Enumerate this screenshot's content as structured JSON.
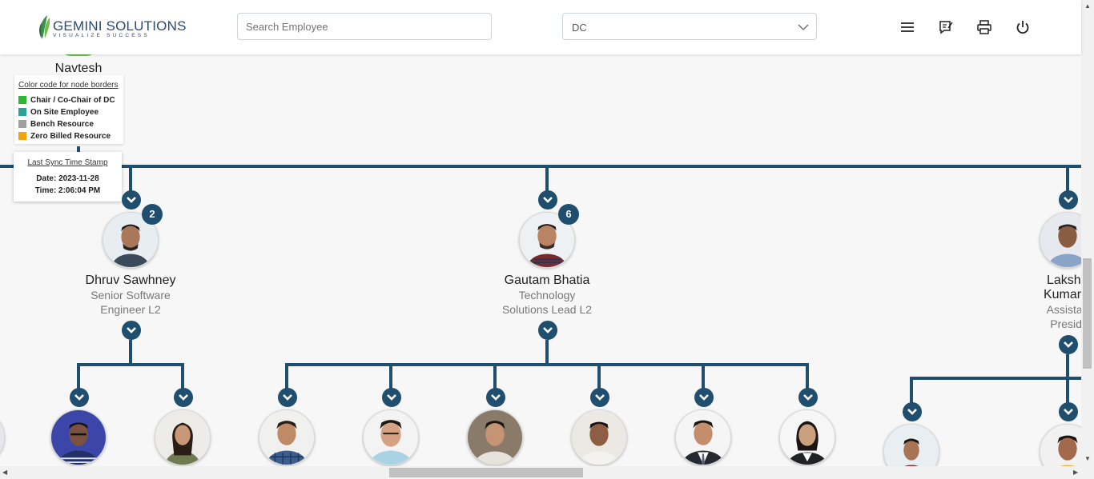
{
  "header": {
    "logo_name": "GEMINI SOLUTIONS",
    "logo_tagline": "VISUALIZE SUCCESS",
    "search_placeholder": "Search Employee",
    "dc_selected": "DC",
    "icons": [
      "menu-icon",
      "feedback-icon",
      "print-icon",
      "power-icon"
    ]
  },
  "colors": {
    "connector": "#1f4e6e",
    "chair": "#2fb52f",
    "onsite": "#2aa19b",
    "bench": "#a0a0a0",
    "zero_billed": "#f2a30a"
  },
  "root": {
    "name": "Navtesh"
  },
  "legend": {
    "title": "Color code for node borders",
    "items": [
      {
        "label": "Chair / Co-Chair of DC",
        "color": "#2fb52f"
      },
      {
        "label": "On Site Employee",
        "color": "#2aa19b"
      },
      {
        "label": "Bench Resource",
        "color": "#a0a0a0"
      },
      {
        "label": "Zero Billed Resource",
        "color": "#f2a30a"
      }
    ]
  },
  "sync": {
    "title": "Last Sync Time Stamp",
    "date": "Date: 2023-11-28",
    "time": "Time: 2:06:04 PM"
  },
  "managers": [
    {
      "name": "Dhruv Sawhney",
      "title_line1": "Senior Software",
      "title_line2": "Engineer L2",
      "reports": "2"
    },
    {
      "name": "Gautam Bhatia",
      "title_line1": "Technology",
      "title_line2": "Solutions Lead L2",
      "reports": "6"
    },
    {
      "name_line1": "Lakshm",
      "name_line2": "Kumar G",
      "title_line1": "Assistant",
      "title_line2": "Preside"
    }
  ]
}
